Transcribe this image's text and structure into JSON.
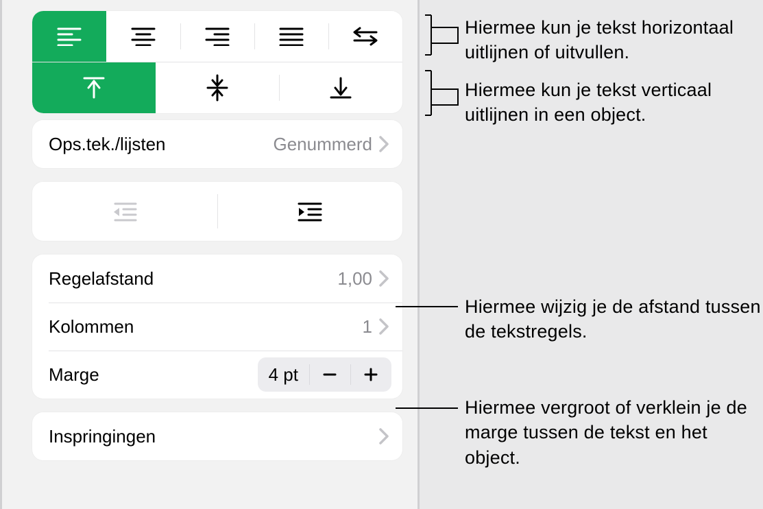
{
  "alignment": {
    "horizontal": {
      "selected": "left",
      "options": [
        "left",
        "center",
        "right",
        "justify",
        "direction"
      ]
    },
    "vertical": {
      "selected": "top",
      "options": [
        "top",
        "middle",
        "bottom"
      ]
    }
  },
  "bullets": {
    "label": "Ops.tek./lijsten",
    "value": "Genummerd"
  },
  "indentControls": {
    "options": [
      "outdent",
      "indent"
    ]
  },
  "lineSpacing": {
    "label": "Regelafstand",
    "value": "1,00"
  },
  "columns": {
    "label": "Kolommen",
    "value": "1"
  },
  "margin": {
    "label": "Marge",
    "value": "4 pt"
  },
  "indents": {
    "label": "Inspringingen"
  },
  "annotations": {
    "hAlign": "Hiermee kun je tekst horizontaal uitlijnen of uitvullen.",
    "vAlign": "Hiermee kun je tekst verticaal uitlijnen in een object.",
    "lineSpacing": "Hiermee wijzig je de afstand tussen de tekstregels.",
    "margin": "Hiermee vergroot of verklein je de marge tussen de tekst en het object."
  }
}
